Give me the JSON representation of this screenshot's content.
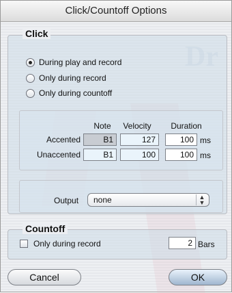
{
  "window": {
    "title": "Click/Countoff Options"
  },
  "click": {
    "title": "Click",
    "mode_options": [
      {
        "label": "During play and record",
        "checked": true
      },
      {
        "label": "Only during record",
        "checked": false
      },
      {
        "label": "Only during countoff",
        "checked": false
      }
    ],
    "columns": {
      "note": "Note",
      "velocity": "Velocity",
      "duration": "Duration"
    },
    "rows": [
      {
        "label": "Accented",
        "note": "B1",
        "velocity": "127",
        "duration": "100",
        "unit": "ms"
      },
      {
        "label": "Unaccented",
        "note": "B1",
        "velocity": "100",
        "duration": "100",
        "unit": "ms"
      }
    ],
    "output": {
      "label": "Output",
      "value": "none"
    }
  },
  "countoff": {
    "title": "Countoff",
    "only_during_record_label": "Only during record",
    "only_during_record_checked": false,
    "bars_value": "2",
    "bars_unit": "Bars"
  },
  "buttons": {
    "cancel": "Cancel",
    "ok": "OK"
  },
  "watermark_text": "Dr"
}
